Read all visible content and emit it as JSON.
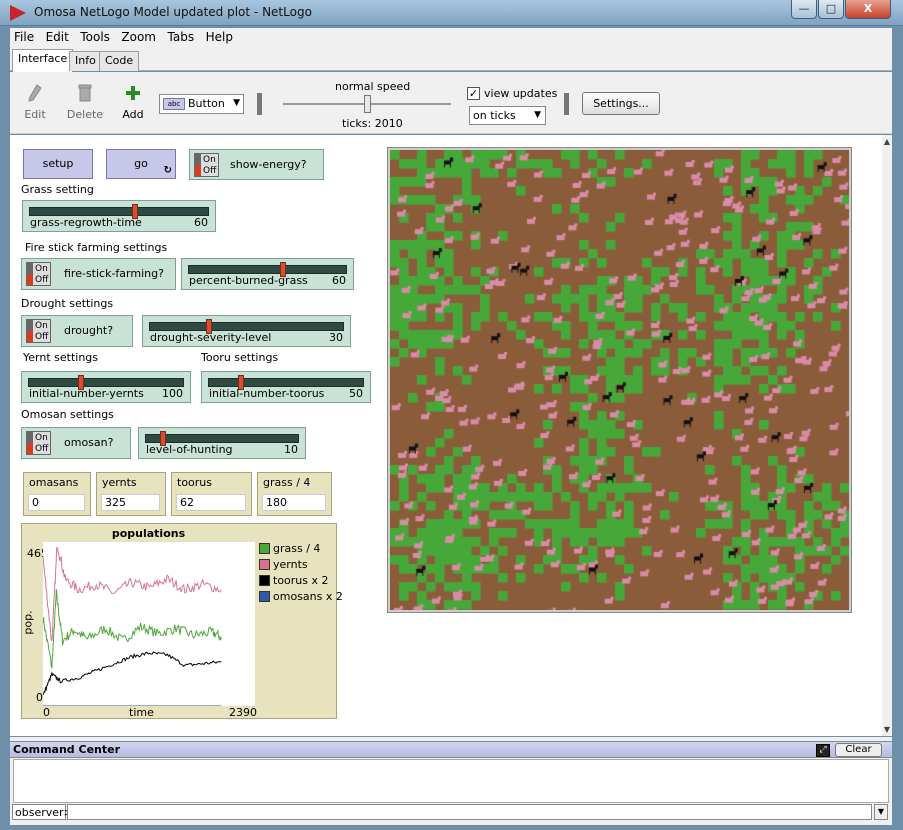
{
  "window": {
    "title": "Omosa NetLogo Model updated plot - NetLogo",
    "controls": {
      "minimize": "—",
      "maximize": "□",
      "close": "X"
    }
  },
  "menu": [
    "File",
    "Edit",
    "Tools",
    "Zoom",
    "Tabs",
    "Help"
  ],
  "tabs": [
    "Interface",
    "Info",
    "Code"
  ],
  "toolbar": {
    "edit": "Edit",
    "delete": "Delete",
    "add": "Add",
    "widget_type": "Button",
    "speed_label": "normal speed",
    "ticks": "ticks: 2010",
    "view_updates_label": "view updates",
    "view_updates_checked": true,
    "update_mode": "on ticks",
    "settings_label": "Settings..."
  },
  "interface": {
    "setup_label": "setup",
    "go_label": "go",
    "go_forever_icon": "↻",
    "switch_on": "On",
    "switch_off": "Off",
    "show_energy": "show-energy?",
    "grass_setting_label": "Grass setting",
    "grass_regrowth": {
      "name": "grass-regrowth-time",
      "value": "60",
      "fraction": 0.59
    },
    "fire_settings_label": "Fire stick farming settings",
    "fire_stick_switch": "fire-stick-farming?",
    "percent_burned": {
      "name": "percent-burned-grass",
      "value": "60",
      "fraction": 0.6
    },
    "drought_settings_label": "Drought settings",
    "drought_switch": "drought?",
    "drought_severity": {
      "name": "drought-severity-level",
      "value": "30",
      "fraction": 0.3
    },
    "yernt_settings_label": "Yernt settings",
    "initial_yernts": {
      "name": "initial-number-yernts",
      "value": "100",
      "fraction": 0.33
    },
    "tooru_settings_label": "Tooru settings",
    "initial_toorus": {
      "name": "initial-number-toorus",
      "value": "50",
      "fraction": 0.2
    },
    "omosan_settings_label": "Omosan settings",
    "omosan_switch": "omosan?",
    "level_of_hunting": {
      "name": "level-of-hunting",
      "value": "10",
      "fraction": 0.1
    },
    "monitors": [
      {
        "name": "omasans",
        "value": "0"
      },
      {
        "name": "yernts",
        "value": "325"
      },
      {
        "name": "toorus",
        "value": "62"
      },
      {
        "name": "grass / 4",
        "value": "180"
      }
    ]
  },
  "chart_data": {
    "type": "line",
    "title": "populations",
    "xlabel": "time",
    "ylabel": "pop.",
    "xlim": [
      0,
      2390
    ],
    "ylim": [
      0,
      465
    ],
    "legend_position": "right",
    "series": [
      {
        "name": "grass / 4",
        "color": "#4da83a",
        "x": [
          0,
          100,
          150,
          220,
          350,
          500,
          700,
          900,
          1100,
          1300,
          1500,
          1700,
          1900,
          2010
        ],
        "values": [
          250,
          110,
          320,
          185,
          215,
          190,
          220,
          185,
          225,
          205,
          220,
          200,
          210,
          195
        ]
      },
      {
        "name": "yernts",
        "color": "#d9728f",
        "x": [
          0,
          100,
          160,
          250,
          400,
          600,
          800,
          1000,
          1200,
          1400,
          1600,
          1800,
          2010
        ],
        "values": [
          420,
          180,
          460,
          360,
          330,
          345,
          320,
          350,
          335,
          360,
          330,
          345,
          330
        ]
      },
      {
        "name": "toorus x 2",
        "color": "#000000",
        "x": [
          0,
          100,
          200,
          400,
          600,
          800,
          1000,
          1200,
          1400,
          1600,
          1800,
          2010
        ],
        "values": [
          30,
          90,
          70,
          80,
          100,
          120,
          140,
          150,
          145,
          115,
          120,
          125
        ]
      },
      {
        "name": "omosans x 2",
        "color": "#3457a8",
        "x": [
          0,
          2010
        ],
        "values": [
          0,
          0
        ]
      }
    ]
  },
  "world": {
    "soil_color": "#8b5c3a",
    "grass_color": "#47a83a",
    "yernt_color": "#d98ca8",
    "tooru_color": "#111111"
  },
  "command_center": {
    "title": "Command Center",
    "clear_label": "Clear",
    "prompt": "observer>"
  }
}
